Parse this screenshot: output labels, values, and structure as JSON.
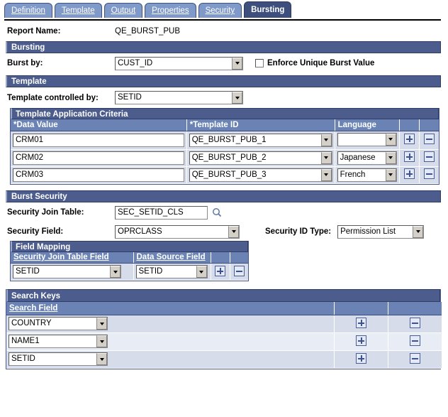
{
  "tabs": [
    {
      "label": "Definition",
      "accel": "D",
      "active": false
    },
    {
      "label": "Template",
      "accel": "T",
      "active": false
    },
    {
      "label": "Output",
      "accel": "O",
      "active": false
    },
    {
      "label": "Properties",
      "accel": "P",
      "active": false
    },
    {
      "label": "Security",
      "accel": "S",
      "active": false
    },
    {
      "label": "Bursting",
      "accel": "B",
      "active": true
    }
  ],
  "report": {
    "name_label": "Report Name:",
    "name_value": "QE_BURST_PUB"
  },
  "bursting": {
    "section_title": "Bursting",
    "burst_by_label": "Burst by:",
    "burst_by_value": "CUST_ID",
    "enforce_unique_label": "Enforce Unique Burst Value",
    "enforce_unique_checked": false
  },
  "template": {
    "section_title": "Template",
    "controlled_by_label": "Template controlled by:",
    "controlled_by_value": "SETID",
    "grid_title": "Template Application Criteria",
    "columns": [
      "*Data Value",
      "*Template ID",
      "Language",
      "",
      ""
    ],
    "rows": [
      {
        "data_value": "CRM01",
        "template_id": "QE_BURST_PUB_1",
        "language": ""
      },
      {
        "data_value": "CRM02",
        "template_id": "QE_BURST_PUB_2",
        "language": "Japanese"
      },
      {
        "data_value": "CRM03",
        "template_id": "QE_BURST_PUB_3",
        "language": "French"
      }
    ],
    "add_label": "+",
    "remove_label": "-"
  },
  "burst_security": {
    "section_title": "Burst Security",
    "join_table_label": "Security Join Table:",
    "join_table_value": "SEC_SETID_CLS",
    "lookup_icon": "magnifier-icon",
    "security_field_label": "Security Field:",
    "security_field_value": "OPRCLASS",
    "security_id_type_label": "Security ID Type:",
    "security_id_type_value": "Permission List",
    "field_mapping": {
      "grid_title": "Field Mapping",
      "columns": [
        "Security Join Table Field",
        "Data Source Field",
        "",
        ""
      ],
      "rows": [
        {
          "join_field": "SETID",
          "source_field": "SETID"
        }
      ]
    }
  },
  "search_keys": {
    "grid_title": "Search Keys",
    "columns": [
      "Search Field",
      "",
      "",
      ""
    ],
    "rows": [
      {
        "search_field": "COUNTRY"
      },
      {
        "search_field": "NAME1"
      },
      {
        "search_field": "SETID"
      }
    ]
  },
  "colors": {
    "section_header": "#4c5c8c",
    "column_header": "#6a82b4",
    "tab_inactive": "#7f9ac9",
    "tab_active": "#3e4f7d",
    "row": "#d6dcea",
    "row_alt": "#e8ecf5",
    "button_accent": "#3d5291"
  }
}
